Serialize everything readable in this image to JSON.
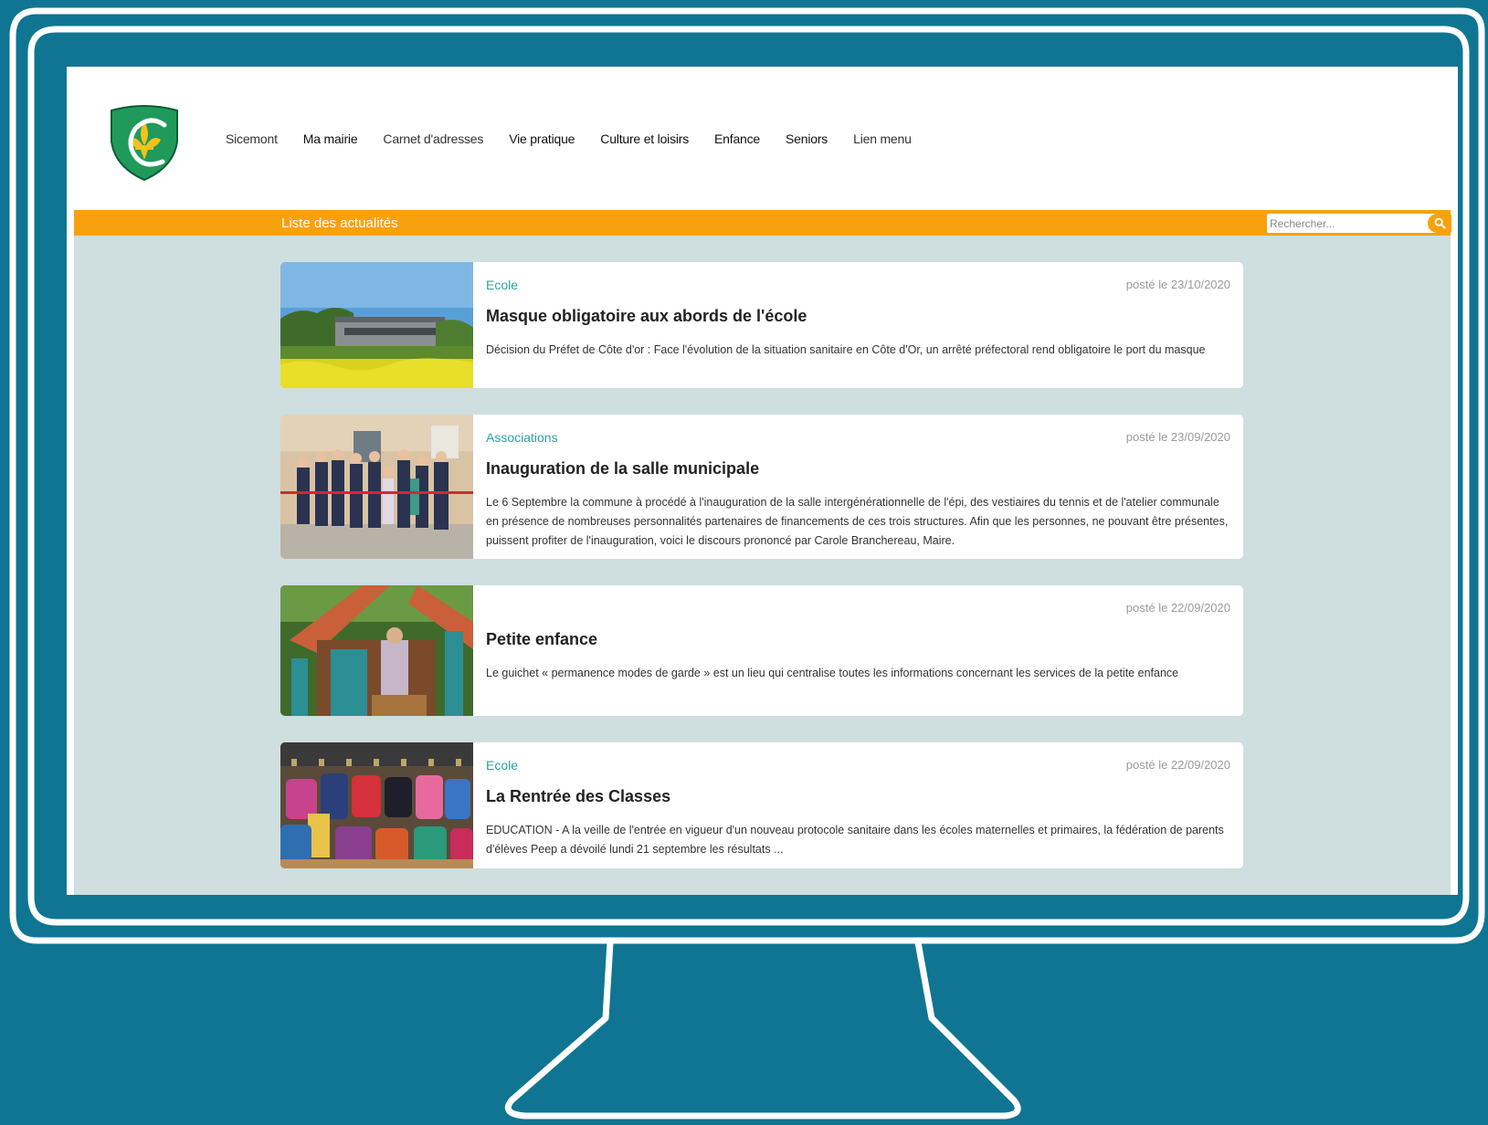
{
  "nav": {
    "items": [
      "Sicemont",
      "Ma mairie",
      "Carnet d'adresses",
      "Vie pratique",
      "Culture et loisirs",
      "Enfance",
      "Seniors",
      "Lien menu"
    ]
  },
  "bar": {
    "title": "Liste des actualités"
  },
  "search": {
    "placeholder": "Rechercher..."
  },
  "articles": [
    {
      "category": "Ecole",
      "date": "posté le 23/10/2020",
      "title": "Masque obligatoire aux abords de l'école",
      "description": "Décision du Préfet de Côte d'or : Face l'évolution de la situation sanitaire en Côte d'Or, un arrêté préfectoral rend obligatoire le port du masque"
    },
    {
      "category": "Associations",
      "date": "posté le 23/09/2020",
      "title": "Inauguration de la salle municipale",
      "description": "Le 6 Septembre la commune à procédé à l'inauguration de la salle intergénérationnelle de l'épi, des vestiaires du tennis et de l'atelier communale en présence de nombreuses personnalités partenaires de financements de ces trois structures. Afin que les personnes, ne pouvant être présentes, puissent profiter de l'inauguration, voici le discours prononcé par Carole Branchereau, Maire."
    },
    {
      "category": "",
      "date": "posté le 22/09/2020",
      "title": "Petite enfance",
      "description": "Le guichet « permanence modes de garde » est un lieu qui centralise toutes les informations concernant les services de la petite enfance"
    },
    {
      "category": "Ecole",
      "date": "posté le 22/09/2020",
      "title": "La Rentrée des Classes",
      "description": "EDUCATION - A la veille de l'entrée en vigueur d'un nouveau protocole sanitaire dans les écoles maternelles et primaires, la fédération de parents d'élèves Peep a dévoilé lundi 21 septembre les résultats ..."
    }
  ],
  "colors": {
    "background": "#0f7592",
    "accent": "#f7a10d",
    "category": "#2aa4a0",
    "content_bg": "#cfdedf"
  },
  "icons": [
    "crest-logo",
    "search-icon"
  ]
}
